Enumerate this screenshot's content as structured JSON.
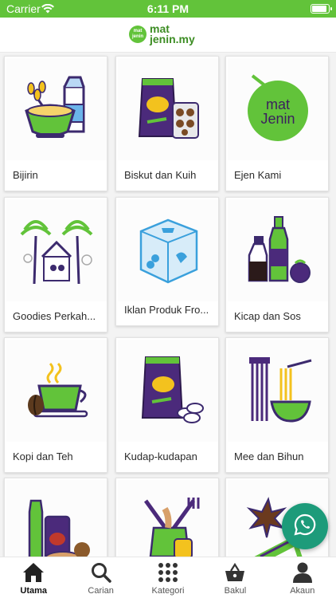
{
  "status_bar": {
    "carrier": "Carrier",
    "time": "6:11 PM"
  },
  "header": {
    "logo_badge": "mat jenin",
    "logo_text_line1": "mat",
    "logo_text_line2": "jenin.my"
  },
  "categories": [
    {
      "label": "Bijirin",
      "icon": "cereal-icon"
    },
    {
      "label": "Biskut dan Kuih",
      "icon": "biscuit-icon"
    },
    {
      "label": "Ejen Kami",
      "icon": "matjenin-coconut-icon"
    },
    {
      "label": "Goodies Perkah...",
      "icon": "wedding-goodies-icon"
    },
    {
      "label": "Iklan Produk Fro...",
      "icon": "frozen-product-icon"
    },
    {
      "label": "Kicap dan Sos",
      "icon": "sauce-bottle-icon"
    },
    {
      "label": "Kopi dan Teh",
      "icon": "coffee-tea-icon"
    },
    {
      "label": "Kudap-kudapan",
      "icon": "snack-bag-icon"
    },
    {
      "label": "Mee dan Bihun",
      "icon": "noodle-icon"
    },
    {
      "label": "",
      "icon": "condiment-jars-icon"
    },
    {
      "label": "",
      "icon": "cooking-ingredients-icon"
    },
    {
      "label": "",
      "icon": "spices-icon"
    }
  ],
  "tabs": [
    {
      "label": "Utama",
      "icon": "home-icon",
      "active": true
    },
    {
      "label": "Carian",
      "icon": "search-icon",
      "active": false
    },
    {
      "label": "Kategori",
      "icon": "grid-icon",
      "active": false
    },
    {
      "label": "Bakul",
      "icon": "basket-icon",
      "active": false
    },
    {
      "label": "Akaun",
      "icon": "user-icon",
      "active": false
    }
  ],
  "colors": {
    "brand_green": "#62c33a",
    "whatsapp_green": "#1d9b7a",
    "purple": "#4b2a7b"
  }
}
